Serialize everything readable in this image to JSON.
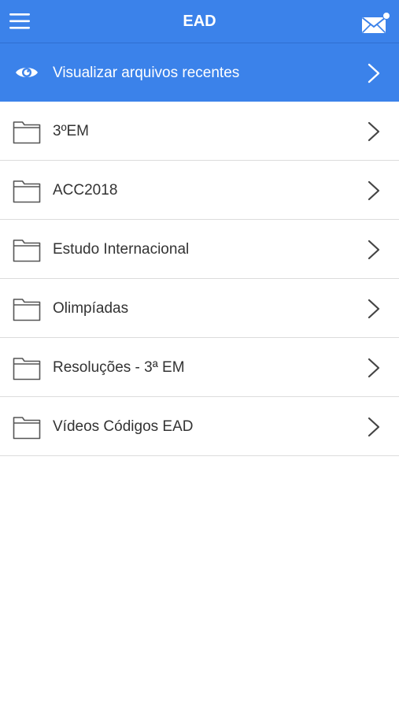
{
  "navbar": {
    "title": "EAD",
    "menu_icon": "hamburger-menu-icon",
    "mail_icon": "envelope-notification-icon",
    "bar_color": "#3b82ea"
  },
  "recent": {
    "label": "Visualizar arquivos recentes",
    "icon": "eye-icon"
  },
  "folders": [
    {
      "label": "3ºEM",
      "icon": "folder-icon"
    },
    {
      "label": "ACC2018",
      "icon": "folder-icon"
    },
    {
      "label": "Estudo Internacional",
      "icon": "folder-icon"
    },
    {
      "label": "Olimpíadas",
      "icon": "folder-icon"
    },
    {
      "label": "Resoluções - 3ª EM",
      "icon": "folder-icon"
    },
    {
      "label": "Vídeos Códigos EAD",
      "icon": "folder-icon"
    }
  ]
}
